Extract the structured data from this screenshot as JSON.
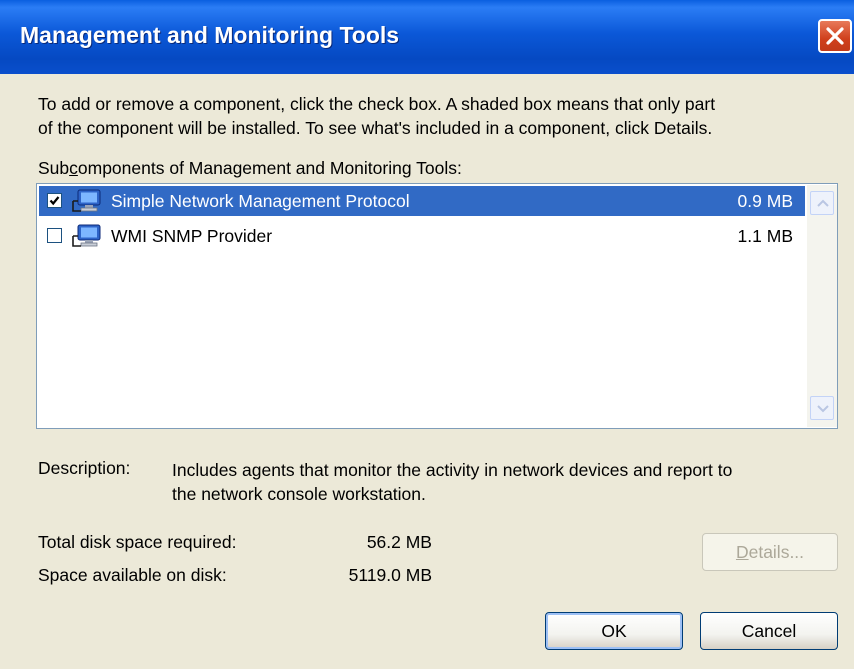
{
  "window": {
    "title": "Management and Monitoring Tools"
  },
  "intro": {
    "line1": "To add or remove a component, click the check box. A shaded box means that only part",
    "line2": "of the component will be installed. To see what's included in a component, click Details."
  },
  "subcomponents": {
    "label_prefix": "Sub",
    "label_accel": "c",
    "label_suffix": "omponents of Management and Monitoring Tools:",
    "items": [
      {
        "name": "Simple Network Management Protocol",
        "size": "0.9 MB",
        "checked": true,
        "selected": true,
        "icon": "network-computer-icon"
      },
      {
        "name": "WMI SNMP Provider",
        "size": "1.1 MB",
        "checked": false,
        "selected": false,
        "icon": "network-computer-icon"
      }
    ]
  },
  "description": {
    "label": "Description:",
    "line1": "Includes agents that monitor the activity in network devices and report to",
    "line2": "the network console workstation."
  },
  "disk": {
    "required_label": "Total disk space required:",
    "required_value": "56.2 MB",
    "available_label": "Space available on disk:",
    "available_value": "5119.0 MB"
  },
  "buttons": {
    "details_accel": "D",
    "details_rest": "etails...",
    "ok": "OK",
    "cancel": "Cancel"
  },
  "colors": {
    "titlebar": "#0549c2",
    "selection": "#316ac5",
    "dialog_bg": "#ece9d8",
    "close": "#d0401c"
  }
}
